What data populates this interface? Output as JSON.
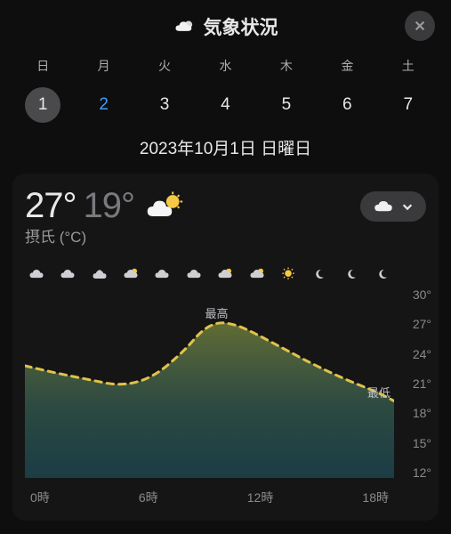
{
  "header": {
    "title": "気象状況",
    "icon": "partly-cloudy"
  },
  "close_aria": "閉じる",
  "week": {
    "labels": [
      "日",
      "月",
      "火",
      "水",
      "木",
      "金",
      "土"
    ]
  },
  "days": {
    "cells": [
      {
        "n": "1",
        "selected": true,
        "accent": false
      },
      {
        "n": "2",
        "selected": false,
        "accent": true
      },
      {
        "n": "3",
        "selected": false,
        "accent": false
      },
      {
        "n": "4",
        "selected": false,
        "accent": false
      },
      {
        "n": "5",
        "selected": false,
        "accent": false
      },
      {
        "n": "6",
        "selected": false,
        "accent": false
      },
      {
        "n": "7",
        "selected": false,
        "accent": false
      }
    ]
  },
  "date_line": "2023年10月1日 日曜日",
  "card": {
    "hi": "27°",
    "lo": "19°",
    "unit": "摂氏 (°C)",
    "labels": {
      "max": "最高",
      "min": "最低"
    }
  },
  "chart_data": {
    "type": "area",
    "title": "",
    "xlabel": "",
    "ylabel": "",
    "ylim": [
      12,
      30
    ],
    "categories": [
      "0時",
      "6時",
      "12時",
      "18時"
    ],
    "yticks": [
      "30°",
      "27°",
      "24°",
      "21°",
      "18°",
      "15°",
      "12°"
    ],
    "series": [
      {
        "name": "temp",
        "x": [
          0,
          2,
          4,
          6,
          8,
          10,
          11,
          12,
          13,
          14,
          16,
          18,
          20,
          22,
          23
        ],
        "values": [
          22.5,
          21.8,
          21.2,
          20.6,
          21.4,
          24.0,
          25.8,
          26.6,
          26.4,
          25.8,
          24.2,
          22.6,
          21.2,
          20.0,
          19.2
        ]
      }
    ],
    "hour_icons": [
      "cloud",
      "cloud",
      "cloud-night",
      "sun-cloud",
      "cloud",
      "cloud",
      "sun-cloud",
      "sun-cloud",
      "sun",
      "moon",
      "moon",
      "moon"
    ],
    "annotations": {
      "max_at_x": 12,
      "min_at_x": 23
    }
  },
  "colors": {
    "bg": "#0e0e0e",
    "card": "#151515",
    "accent_day": "#3aa0ff",
    "line": "#e0c24b",
    "area_top": "#6b7a3a",
    "area_bottom": "#1f5d6b"
  }
}
